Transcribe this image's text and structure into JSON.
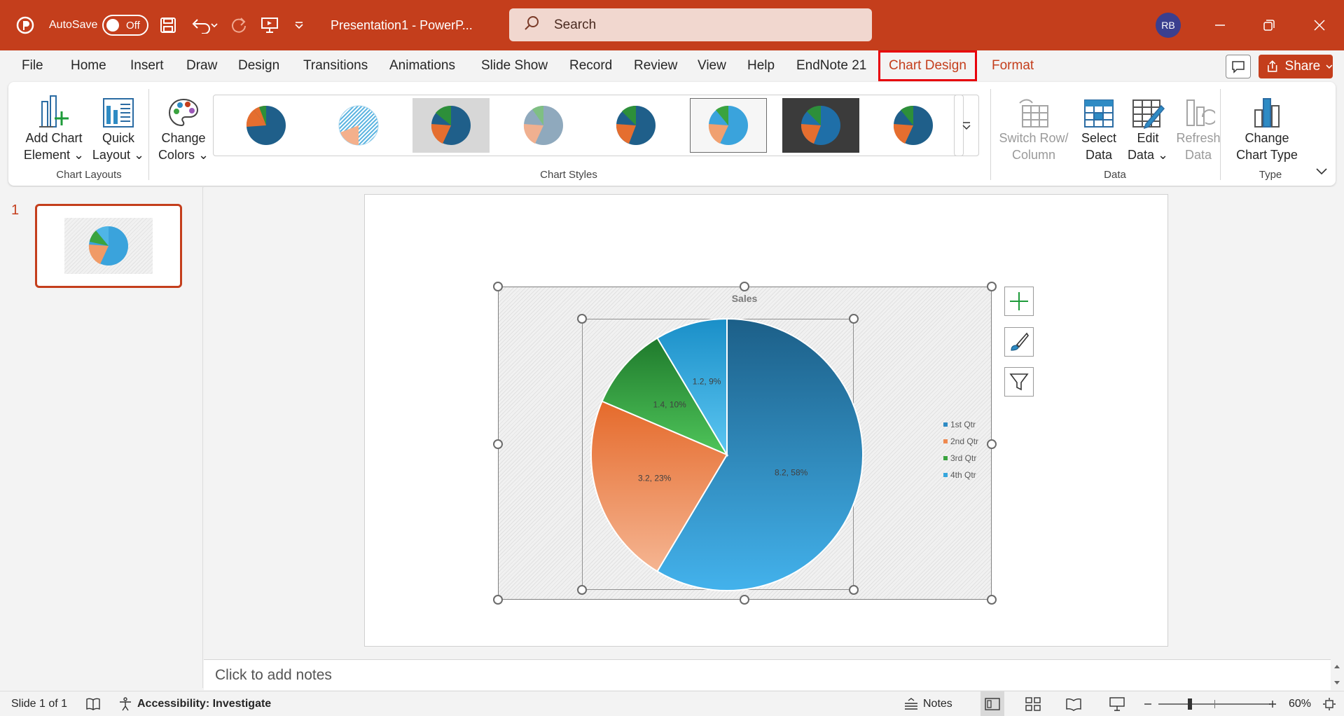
{
  "titlebar": {
    "autosave_label": "AutoSave",
    "autosave_state": "Off",
    "doc_title": "Presentation1  -  PowerP...",
    "search_placeholder": "Search",
    "avatar_initials": "RB"
  },
  "tabs": [
    {
      "label": "File"
    },
    {
      "label": "Home"
    },
    {
      "label": "Insert"
    },
    {
      "label": "Draw"
    },
    {
      "label": "Design"
    },
    {
      "label": "Transitions"
    },
    {
      "label": "Animations"
    },
    {
      "label": "Slide Show"
    },
    {
      "label": "Record"
    },
    {
      "label": "Review"
    },
    {
      "label": "View"
    },
    {
      "label": "Help"
    },
    {
      "label": "EndNote 21"
    },
    {
      "label": "Chart Design"
    },
    {
      "label": "Format"
    }
  ],
  "share_label": "Share",
  "ribbon": {
    "add_chart_element": [
      "Add Chart",
      "Element"
    ],
    "quick_layout": [
      "Quick",
      "Layout"
    ],
    "change_colors": [
      "Change",
      "Colors"
    ],
    "switch_row_column": [
      "Switch Row/",
      "Column"
    ],
    "select_data": [
      "Select",
      "Data"
    ],
    "edit_data": [
      "Edit",
      "Data"
    ],
    "refresh_data": [
      "Refresh",
      "Data"
    ],
    "change_chart_type": [
      "Change",
      "Chart Type"
    ],
    "groups": {
      "chart_layouts": "Chart Layouts",
      "chart_styles": "Chart Styles",
      "data": "Data",
      "type": "Type"
    }
  },
  "thumbnails": {
    "slide_number": "1"
  },
  "notes_placeholder": "Click to add notes",
  "statusbar": {
    "slide_info": "Slide 1 of 1",
    "accessibility": "Accessibility: Investigate",
    "notes_label": "Notes",
    "zoom": "60%"
  },
  "colors": {
    "brand": "#c43e1c",
    "qtr1": "#2e8bc4",
    "qtr2": "#ee8950",
    "qtr3": "#3aa33f",
    "qtr4": "#36a6dd"
  },
  "chart_data": {
    "type": "pie",
    "title": "Sales",
    "categories": [
      "1st Qtr",
      "2nd Qtr",
      "3rd Qtr",
      "4th Qtr"
    ],
    "values": [
      8.2,
      3.2,
      1.4,
      1.2
    ],
    "data_labels": [
      "8.2, 58%",
      "3.2, 23%",
      "1.4, 10%",
      "1.2, 9%"
    ],
    "legend_position": "right"
  }
}
